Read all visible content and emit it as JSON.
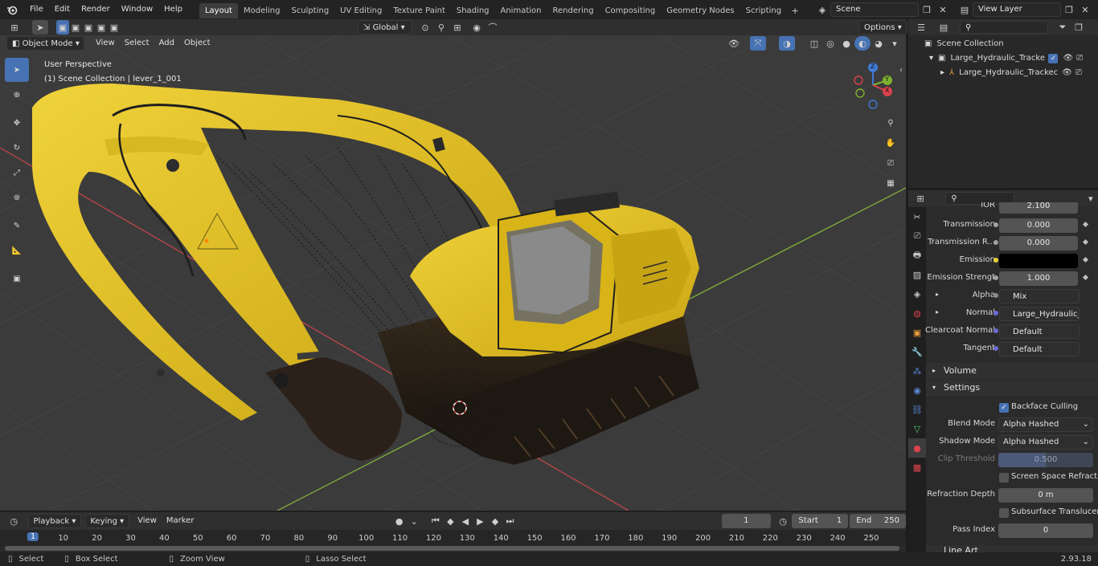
{
  "topbar": {
    "menus": [
      "File",
      "Edit",
      "Render",
      "Window",
      "Help"
    ],
    "workspaces": [
      "Layout",
      "Modeling",
      "Sculpting",
      "UV Editing",
      "Texture Paint",
      "Shading",
      "Animation",
      "Rendering",
      "Compositing",
      "Geometry Nodes",
      "Scripting"
    ],
    "active_workspace": "Layout",
    "scene_name": "Scene",
    "view_layer": "View Layer"
  },
  "viewport_header": {
    "mode": "Object Mode",
    "menus": [
      "View",
      "Select",
      "Add",
      "Object"
    ],
    "transform_orientation": "Global",
    "options_label": "Options"
  },
  "viewport": {
    "perspective_label": "User Perspective",
    "collection_label": "(1) Scene Collection | lever_1_001",
    "gizmo_axes": {
      "x": "X",
      "y": "Y",
      "z": "Z"
    },
    "colors": {
      "body_yellow": "#e8c71c",
      "grid_red": "#b5454a",
      "grid_green": "#7fa83a"
    }
  },
  "outliner": {
    "root": "Scene Collection",
    "items": [
      {
        "label": "Large_Hydraulic_Tracked_Exc",
        "depth": 1
      },
      {
        "label": "Large_Hydraulic_Trackec",
        "depth": 2
      }
    ]
  },
  "properties": {
    "top_cut_label": "IOR",
    "top_cut_value": "2.100",
    "rows": [
      {
        "label": "Transmission",
        "value": "0.000"
      },
      {
        "label": "Transmission R...",
        "value": "0.000"
      },
      {
        "label": "Emission",
        "value": ""
      },
      {
        "label": "Emission Strengt",
        "value": "1.000"
      }
    ],
    "links": [
      {
        "label": "Alpha",
        "value": "Mix"
      },
      {
        "label": "Normal",
        "value": "Large_Hydraulic_Tra..."
      },
      {
        "label": "Clearcoat Normal",
        "value": "Default"
      },
      {
        "label": "Tangent",
        "value": "Default"
      }
    ],
    "sections": {
      "volume": "Volume",
      "settings": "Settings",
      "line_art": "Line Art"
    },
    "settings": {
      "backface_culling": "Backface Culling",
      "blend_mode_label": "Blend Mode",
      "blend_mode": "Alpha Hashed",
      "shadow_mode_label": "Shadow Mode",
      "shadow_mode": "Alpha Hashed",
      "clip_threshold_label": "Clip Threshold",
      "clip_threshold": "0.500",
      "ssr": "Screen Space Refraction",
      "refraction_depth_label": "Refraction Depth",
      "refraction_depth": "0 m",
      "subsurface": "Subsurface Translucency",
      "pass_index_label": "Pass Index",
      "pass_index": "0"
    }
  },
  "timeline": {
    "menus": [
      "Playback",
      "Keying",
      "View",
      "Marker"
    ],
    "current_frame": "1",
    "start_label": "Start",
    "start": "1",
    "end_label": "End",
    "end": "250",
    "ruler_ticks": [
      "1",
      "10",
      "20",
      "30",
      "40",
      "50",
      "60",
      "70",
      "80",
      "90",
      "100",
      "110",
      "120",
      "130",
      "140",
      "150",
      "160",
      "170",
      "180",
      "190",
      "200",
      "210",
      "220",
      "230",
      "240",
      "250"
    ]
  },
  "statusbar": {
    "hints": [
      "Select",
      "Box Select",
      "Zoom View",
      "Lasso Select"
    ],
    "version": "2.93.18"
  }
}
